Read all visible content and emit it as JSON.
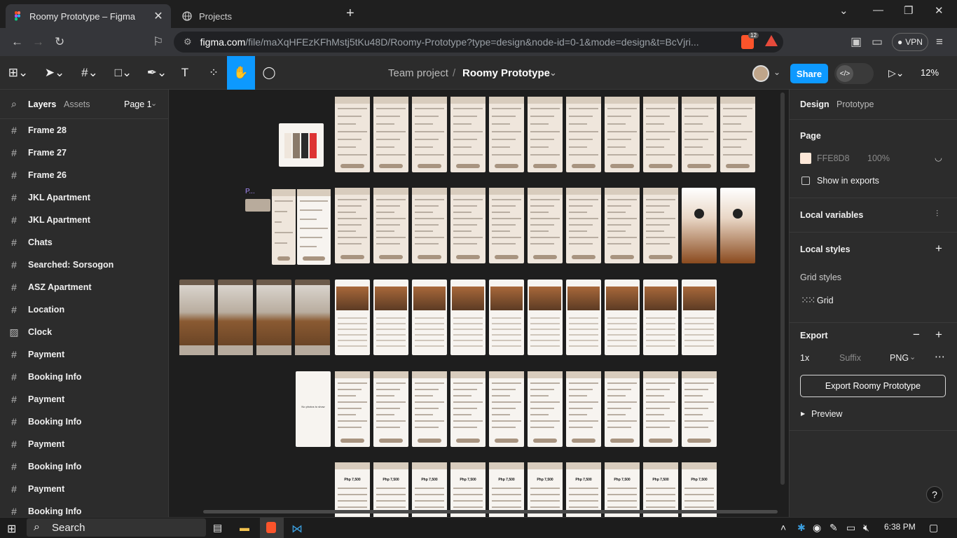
{
  "browser": {
    "tabs": [
      {
        "title": "Roomy Prototype – Figma",
        "active": true
      },
      {
        "title": "Projects",
        "active": false
      }
    ],
    "url_domain": "figma.com",
    "url_path": "/file/maXqHFEzKFhMstj5tKu48D/Roomy-Prototype?type=design&node-id=0-1&mode=design&t=BcVjri...",
    "badge_count": "12",
    "vpn_label": "VPN"
  },
  "figma": {
    "breadcrumb_team": "Team project",
    "breadcrumb_sep": "/",
    "file_name": "Roomy Prototype",
    "share_label": "Share",
    "zoom": "12%",
    "tools": [
      "main-menu",
      "move",
      "frame",
      "shape",
      "pen",
      "text",
      "resources",
      "hand",
      "comment"
    ],
    "selected_tool": "hand"
  },
  "left_panel": {
    "tab_layers": "Layers",
    "tab_assets": "Assets",
    "page_selector": "Page 1",
    "layers": [
      {
        "name": "Frame 28",
        "icon": "frame-icon"
      },
      {
        "name": "Frame 27",
        "icon": "frame-icon"
      },
      {
        "name": "Frame 26",
        "icon": "frame-icon"
      },
      {
        "name": "JKL Apartment",
        "icon": "frame-icon"
      },
      {
        "name": "JKL Apartment",
        "icon": "frame-icon"
      },
      {
        "name": "Chats",
        "icon": "frame-icon"
      },
      {
        "name": "Searched: Sorsogon",
        "icon": "frame-icon"
      },
      {
        "name": "ASZ Apartment",
        "icon": "frame-icon"
      },
      {
        "name": "Location",
        "icon": "frame-icon"
      },
      {
        "name": "Clock",
        "icon": "image-icon"
      },
      {
        "name": "Payment",
        "icon": "frame-icon"
      },
      {
        "name": "Booking Info",
        "icon": "frame-icon"
      },
      {
        "name": "Payment",
        "icon": "frame-icon"
      },
      {
        "name": "Booking Info",
        "icon": "frame-icon"
      },
      {
        "name": "Payment",
        "icon": "frame-icon"
      },
      {
        "name": "Booking Info",
        "icon": "frame-icon"
      },
      {
        "name": "Payment",
        "icon": "frame-icon"
      },
      {
        "name": "Booking Info",
        "icon": "frame-icon"
      }
    ]
  },
  "canvas": {
    "no_photos_text": "No photos to show",
    "price_label": "Php 7,500",
    "component_label": "P..."
  },
  "right_panel": {
    "tab_design": "Design",
    "tab_prototype": "Prototype",
    "page_heading": "Page",
    "page_color": "FFE8D8",
    "page_color_swatch": "#fde8d8",
    "page_opacity": "100%",
    "show_in_exports": "Show in exports",
    "local_variables": "Local variables",
    "local_styles": "Local styles",
    "grid_styles": "Grid styles",
    "grid_label": "Grid",
    "export_heading": "Export",
    "export_scale": "1x",
    "export_suffix_placeholder": "Suffix",
    "export_format": "PNG",
    "export_button": "Export Roomy Prototype",
    "preview_label": "Preview",
    "help": "?"
  },
  "taskbar": {
    "search_label": "Search",
    "time": "6:38 PM"
  },
  "colors": {
    "accent": "#0d99ff",
    "panel": "#2c2c2c",
    "canvas": "#1e1e1e"
  }
}
